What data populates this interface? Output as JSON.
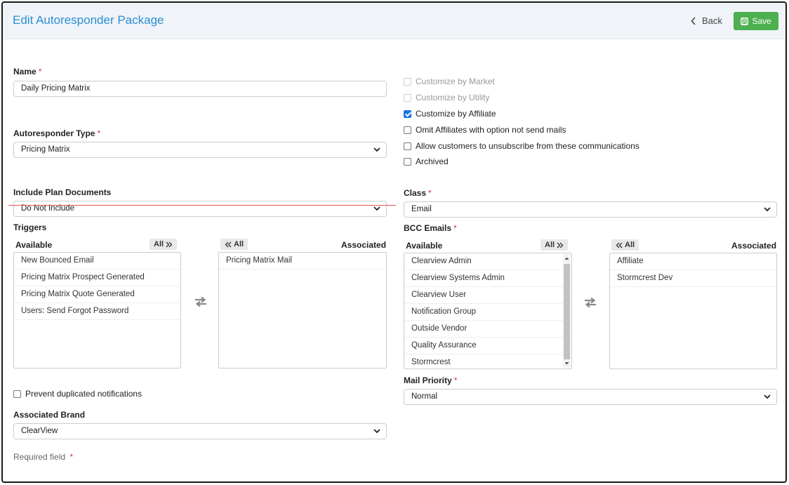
{
  "header": {
    "title": "Edit Autoresponder Package",
    "back_label": "Back",
    "save_label": "Save"
  },
  "form": {
    "name": {
      "label": "Name",
      "required": "*",
      "value": "Daily Pricing Matrix"
    },
    "type": {
      "label": "Autoresponder Type",
      "required": "*",
      "value": "Pricing Matrix"
    },
    "plan_docs": {
      "label": "Include Plan Documents",
      "value": "Do Not Include"
    },
    "class": {
      "label": "Class",
      "required": "*",
      "value": "Email"
    },
    "mail_priority": {
      "label": "Mail Priority",
      "required": "*",
      "value": "Normal"
    },
    "brand": {
      "label": "Associated Brand",
      "value": "ClearView"
    },
    "prevent_dup": {
      "label": "Prevent duplicated notifications",
      "checked": false
    },
    "required_note": {
      "text": "Required field",
      "star": "*"
    }
  },
  "options": [
    {
      "label": "Customize by Market",
      "checked": false,
      "disabled": true
    },
    {
      "label": "Customize by Utility",
      "checked": false,
      "disabled": true
    },
    {
      "label": "Customize by Affiliate",
      "checked": true,
      "disabled": false
    },
    {
      "label": "Omit Affiliates with option not send mails",
      "checked": false,
      "disabled": false
    },
    {
      "label": "Allow customers to unsubscribe from these communications",
      "checked": false,
      "disabled": false
    },
    {
      "label": "Archived",
      "checked": false,
      "disabled": false
    }
  ],
  "triggers": {
    "label": "Triggers",
    "available_label": "Available",
    "associated_label": "Associated",
    "all_right_label": "All",
    "all_left_label": "All",
    "available": [
      "New Bounced Email",
      "Pricing Matrix Prospect Generated",
      "Pricing Matrix Quote Generated",
      "Users: Send Forgot Password"
    ],
    "associated": [
      "Pricing Matrix Mail"
    ]
  },
  "bcc": {
    "label": "BCC Emails",
    "required": "*",
    "available_label": "Available",
    "associated_label": "Associated",
    "all_right_label": "All",
    "all_left_label": "All",
    "available": [
      "Clearview Admin",
      "Clearview Systems Admin",
      "Clearview User",
      "Notification Group",
      "Outside Vendor",
      "Quality Assurance",
      "Stormcrest"
    ],
    "associated": [
      "Affiliate",
      "Stormcrest Dev"
    ]
  },
  "colors": {
    "accent": "#2a8fd6",
    "save": "#4caf50",
    "required": "#d9343c",
    "check": "#1a73e8"
  }
}
